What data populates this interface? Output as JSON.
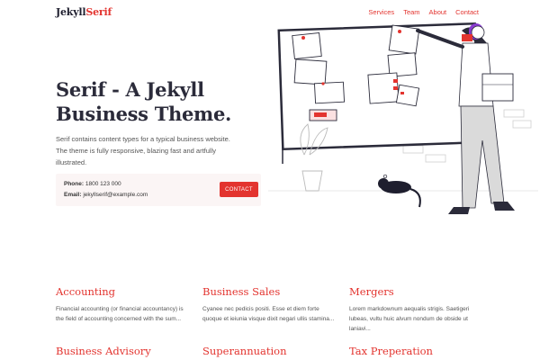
{
  "brand": {
    "part1": "Jekyll",
    "part2": "Serif"
  },
  "nav": [
    "Services",
    "Team",
    "About",
    "Contact"
  ],
  "hero": {
    "title": "Serif - A Jekyll Business Theme.",
    "description": "Serif contains content types for a typical business website. The theme is fully responsive, blazing fast and artfully illustrated."
  },
  "contact": {
    "phone_label": "Phone:",
    "phone": "1800 123 000",
    "email_label": "Email:",
    "email": "jekyllserif@example.com",
    "button": "CONTACT"
  },
  "services": [
    {
      "title": "Accounting",
      "text": "Financial accounting (or financial accountancy) is the field of accounting concerned with the sum..."
    },
    {
      "title": "Business Sales",
      "text": "Cyanee nec pedicis positi. Esse et diem forte quoque et ieiunia visque dixit negari ullis stamina..."
    },
    {
      "title": "Mergers",
      "text": "Lorem markdownum aequalis strigis. Saetigeri lubeas, vultu huic alvum nondum de obside ut laniavi..."
    },
    {
      "title": "Business Advisory",
      "text": ""
    },
    {
      "title": "Superannuation",
      "text": ""
    },
    {
      "title": "Tax Preperation",
      "text": ""
    }
  ],
  "colors": {
    "accent": "#e3342f",
    "heading": "#2b2b3a",
    "contact_bg": "#fbf5f5"
  }
}
